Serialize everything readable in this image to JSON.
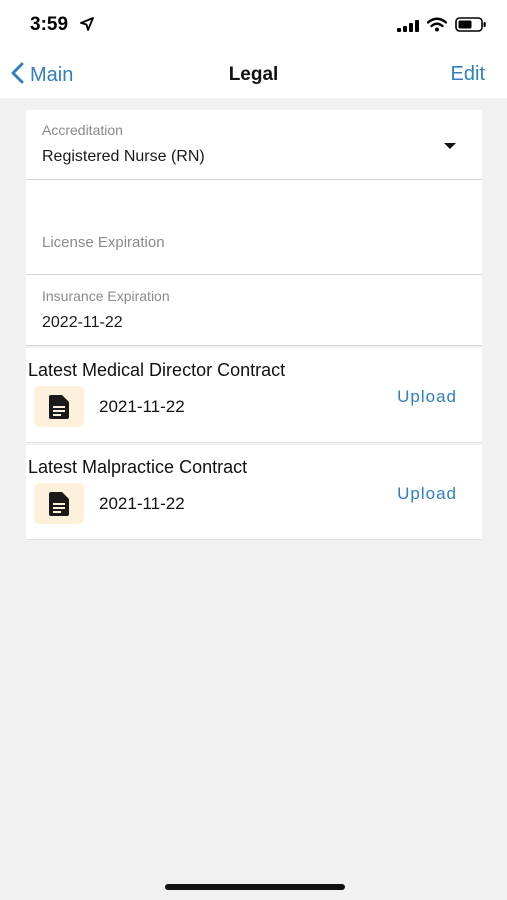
{
  "status_bar": {
    "time": "3:59"
  },
  "nav": {
    "back_label": "Main",
    "title": "Legal",
    "edit_label": "Edit"
  },
  "fields": {
    "accreditation": {
      "label": "Accreditation",
      "value": "Registered Nurse (RN)"
    },
    "license_expiration": {
      "label": "License Expiration",
      "value": ""
    },
    "insurance_expiration": {
      "label": "Insurance Expiration",
      "value": "2022-11-22"
    }
  },
  "documents": [
    {
      "title": "Latest Medical Director Contract",
      "date": "2021-11-22",
      "action": "Upload",
      "icon": "document-icon"
    },
    {
      "title": "Latest Malpractice Contract",
      "date": "2021-11-22",
      "action": "Upload",
      "icon": "document-icon"
    }
  ],
  "colors": {
    "accent": "#2f7fc1",
    "background": "#f1f1f1",
    "icon_tile": "#fdf1dc"
  }
}
